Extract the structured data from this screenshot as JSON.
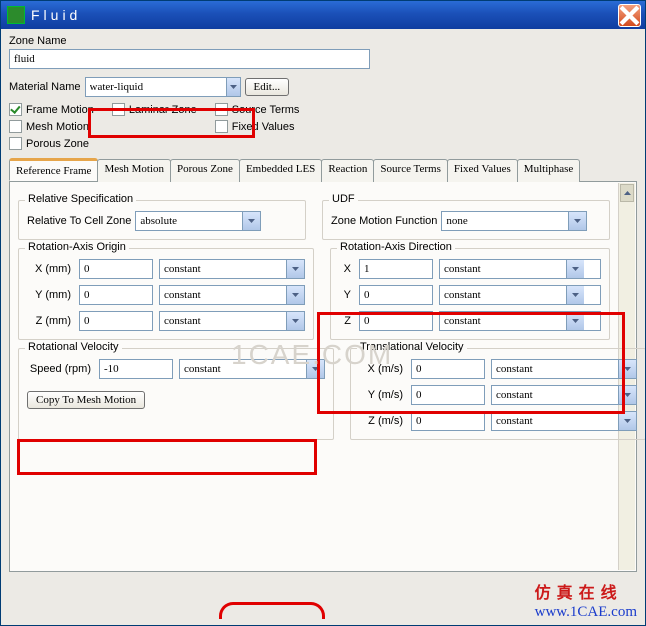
{
  "window": {
    "title": "Fluid"
  },
  "zone": {
    "label": "Zone Name",
    "value": "fluid"
  },
  "material": {
    "label": "Material Name",
    "value": "water-liquid",
    "edit": "Edit..."
  },
  "checks": {
    "frame_motion": "Frame Motion",
    "mesh_motion": "Mesh Motion",
    "porous_zone": "Porous Zone",
    "laminar_zone": "Laminar Zone",
    "source_terms": "Source Terms",
    "fixed_values": "Fixed Values"
  },
  "tabs": [
    "Reference Frame",
    "Mesh Motion",
    "Porous Zone",
    "Embedded LES",
    "Reaction",
    "Source Terms",
    "Fixed Values",
    "Multiphase"
  ],
  "ref_frame": {
    "relative_spec": {
      "title": "Relative Specification",
      "label": "Relative To Cell Zone",
      "value": "absolute"
    },
    "udf": {
      "title": "UDF",
      "label": "Zone Motion Function",
      "value": "none"
    },
    "rot_origin": {
      "title": "Rotation-Axis Origin",
      "x_label": "X (mm)",
      "x_val": "0",
      "x_mode": "constant",
      "y_label": "Y (mm)",
      "y_val": "0",
      "y_mode": "constant",
      "z_label": "Z (mm)",
      "z_val": "0",
      "z_mode": "constant"
    },
    "rot_dir": {
      "title": "Rotation-Axis Direction",
      "x_label": "X",
      "x_val": "1",
      "x_mode": "constant",
      "y_label": "Y",
      "y_val": "0",
      "y_mode": "constant",
      "z_label": "Z",
      "z_val": "0",
      "z_mode": "constant"
    },
    "rot_vel": {
      "title": "Rotational Velocity",
      "speed_label": "Speed (rpm)",
      "speed_val": "-10",
      "speed_mode": "constant",
      "copy_btn": "Copy To Mesh Motion"
    },
    "trans_vel": {
      "title": "Translational Velocity",
      "x_label": "X (m/s)",
      "x_val": "0",
      "x_mode": "constant",
      "y_label": "Y (m/s)",
      "y_val": "0",
      "y_mode": "constant",
      "z_label": "Z (m/s)",
      "z_val": "0",
      "z_mode": "constant"
    }
  },
  "footer": {
    "cn_text": "仿真在线",
    "url": "www.1CAE.com"
  }
}
